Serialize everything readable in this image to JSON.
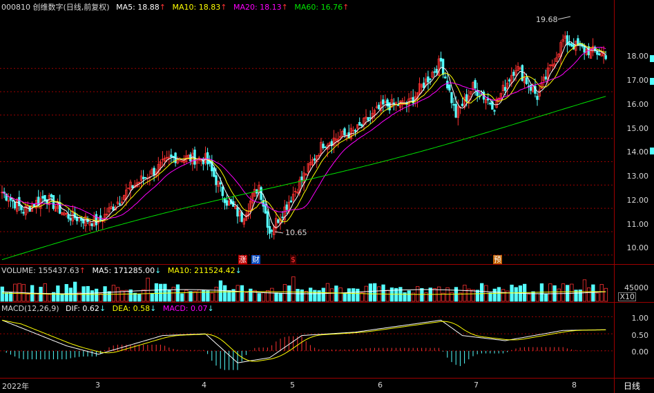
{
  "stock": {
    "title": "000810 创维数字(日线,前复权)",
    "ma5": "MA5: 18.88",
    "ma10": "MA10: 18.83",
    "ma20": "MA20: 18.13",
    "ma60": "MA60: 16.76",
    "arrow": "↑",
    "high_label": "19.68",
    "low_label": "10.65",
    "price_ticks": [
      "18.00",
      "17.00",
      "16.00",
      "15.00",
      "14.00",
      "13.00",
      "12.00",
      "11.00",
      "10.00"
    ],
    "events": [
      "涨",
      "财",
      "$",
      "预"
    ]
  },
  "volume": {
    "title": "VOLUME: 155437.63",
    "ma5": "MA5: 171285.00",
    "ma10": "MA10: 211524.42",
    "arrow_up": "↑",
    "arrow_down": "↓",
    "tick": "45000",
    "unit": "X10"
  },
  "macd": {
    "title": "MACD(12,26,9)",
    "dif": "DIF: 0.62",
    "dea": "DEA: 0.58",
    "macd": "MACD: 0.07",
    "arrow": "↓",
    "ticks": [
      "1.00",
      "0.50",
      "0.00"
    ]
  },
  "xaxis": {
    "labels": [
      "2022年",
      "3",
      "4",
      "5",
      "6",
      "7",
      "8"
    ],
    "period_tab": "日线"
  },
  "colors": {
    "up": "#ff3232",
    "down": "#54ffff",
    "ma5": "#ffffff",
    "ma10": "#ffff00",
    "ma20": "#ff00ff",
    "ma60": "#00e600",
    "grid": "#a00000"
  },
  "chart_data": {
    "type": "candlestick",
    "price_range": [
      9.7,
      20.4
    ],
    "macd_range": [
      -0.75,
      1.15
    ]
  }
}
